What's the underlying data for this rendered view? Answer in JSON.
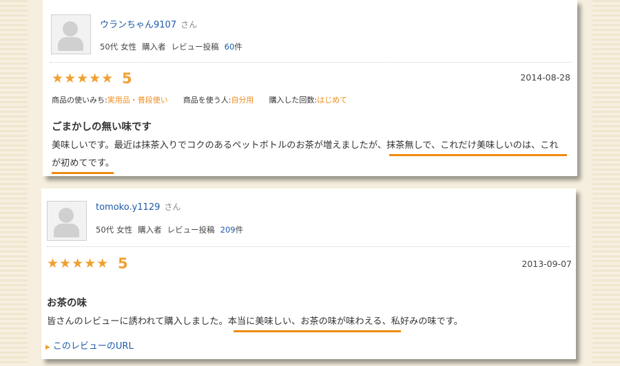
{
  "reviews": [
    {
      "user": {
        "name": "ウランちゃん9107",
        "san": "さん",
        "age": "50代",
        "gender": "女性",
        "buyer": "購入者",
        "post_label": "レビュー投稿",
        "count": "60",
        "count_unit": "件"
      },
      "stars": "★★★★★",
      "rating": "5",
      "date": "2014-08-28",
      "usage": {
        "how_label": "商品の使いみち:",
        "how_value": "実用品・普段使い",
        "who_label": "商品を使う人:",
        "who_value": "自分用",
        "times_label": "購入した回数:",
        "times_value": "はじめて"
      },
      "title": "ごまかしの無い味です",
      "body_line1": "美味しいです。最近は抹茶入りでコクのあるペットボトルのお茶が増えましたが、抹茶無しで、これだけ美味しいのは、これ",
      "body_line2": "が初めてです。"
    },
    {
      "user": {
        "name": "tomoko.y1129",
        "san": "さん",
        "age": "50代",
        "gender": "女性",
        "buyer": "購入者",
        "post_label": "レビュー投稿",
        "count": "209",
        "count_unit": "件"
      },
      "stars": "★★★★★",
      "rating": "5",
      "date": "2013-09-07",
      "title": "お茶の味",
      "body": "皆さんのレビューに誘われて購入しました。本当に美味しい、お茶の味が味わえる、私好みの味です。",
      "link": "このレビューのURL"
    }
  ],
  "colors": {
    "accent_orange": "#f0a030",
    "underline": "#ef8b0e",
    "link_blue": "#1c5aa8"
  }
}
